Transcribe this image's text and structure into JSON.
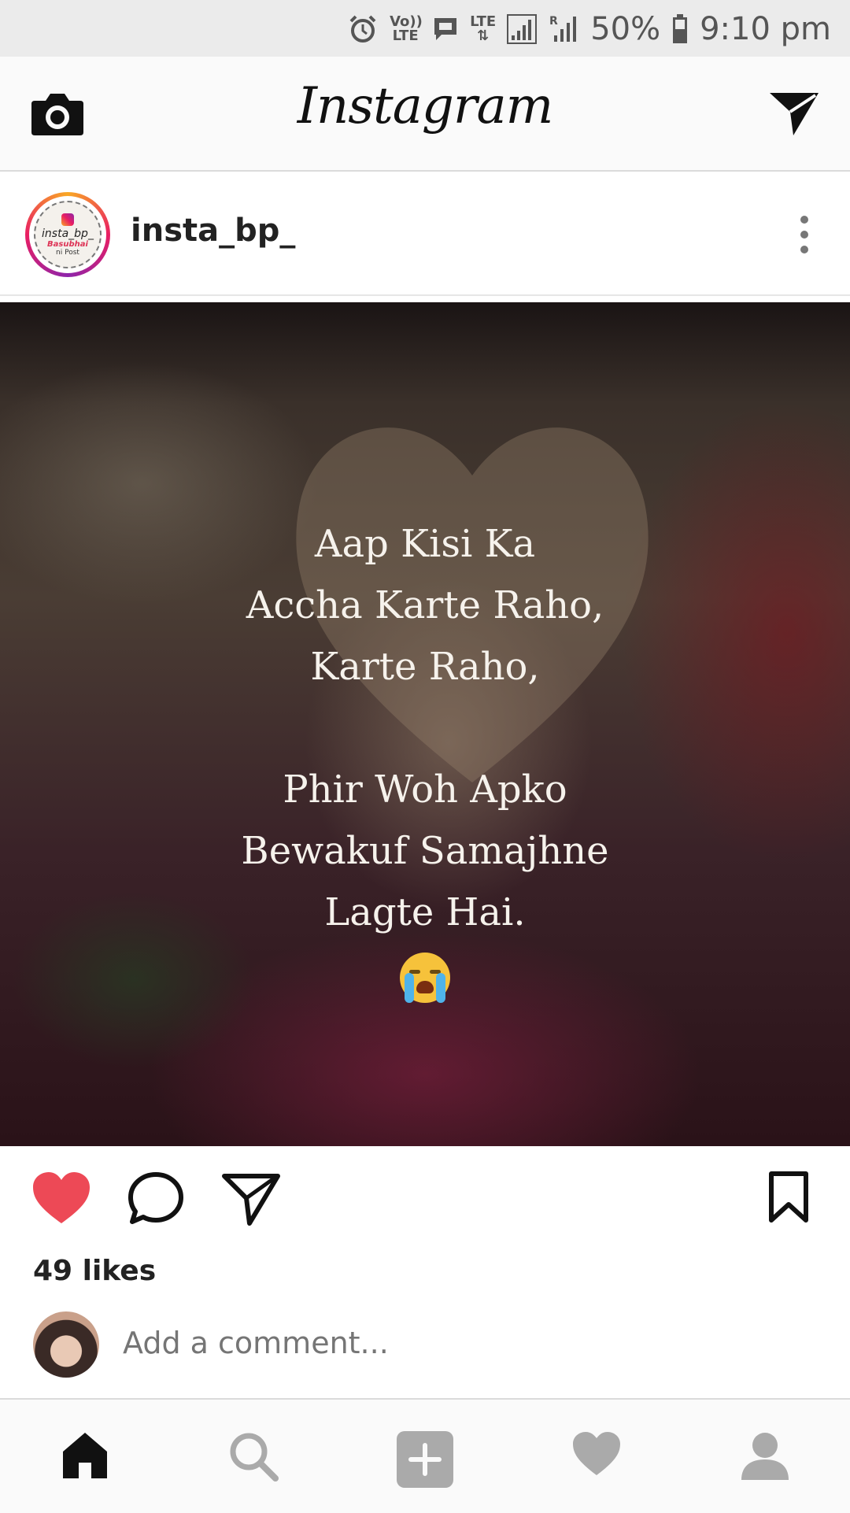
{
  "status_bar": {
    "battery": "50%",
    "time": "9:10 pm",
    "volte": "Vo)) LTE",
    "lte": "LTE",
    "roaming": "R"
  },
  "header": {
    "title": "Instagram"
  },
  "post": {
    "username": "insta_bp_",
    "avatar_text_1": "insta_bp_",
    "avatar_text_2": "Basubhai",
    "avatar_text_3": "ni Post",
    "image_text": {
      "line1": "Aap Kisi Ka",
      "line2": "Accha Karte Raho,",
      "line3": "Karte Raho,",
      "line4": "Phir Woh Apko",
      "line5": "Bewakuf Samajhne",
      "line6": "Lagte Hai."
    },
    "emoji_name": "loudly-crying-face",
    "liked": true,
    "like_color": "#ed4956",
    "likes": "49 likes"
  },
  "comment": {
    "placeholder": "Add a comment..."
  },
  "nav": {
    "items": [
      "home",
      "search",
      "add",
      "activity",
      "profile"
    ],
    "active": "home"
  }
}
